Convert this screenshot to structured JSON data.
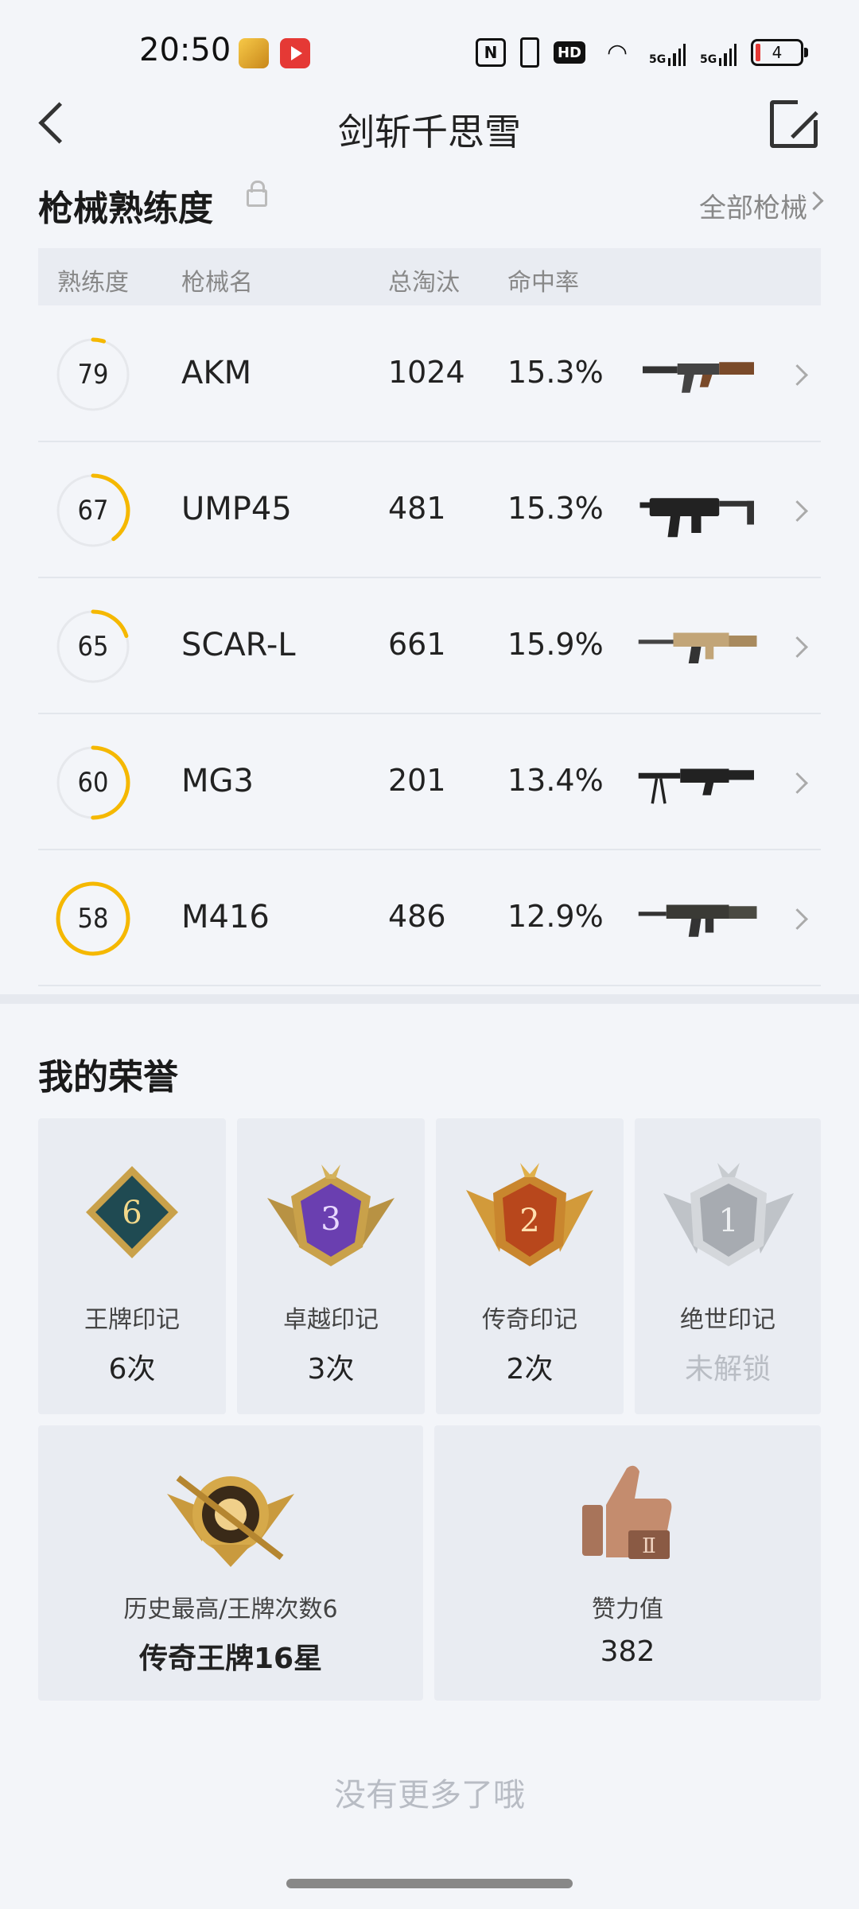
{
  "status_bar": {
    "time": "20:50",
    "icons": [
      "nfc-icon",
      "vibrate-icon",
      "hd-icon",
      "wifi-icon",
      "signal-5g-icon",
      "signal-5g-icon",
      "battery-icon"
    ],
    "hd_label": "HD",
    "sig_label": "5G",
    "battery_level": "4"
  },
  "header": {
    "title": "剑斩千思雪",
    "back_icon": "back-chevron-icon",
    "share_icon": "share-external-icon"
  },
  "weapons": {
    "section_title": "枪械熟练度",
    "all_link": "全部枪械",
    "columns": [
      "熟练度",
      "枪械名",
      "总淘汰",
      "命中率"
    ],
    "rows": [
      {
        "proficiency": "79",
        "progress": 0.05,
        "name": "AKM",
        "kills": "1024",
        "accuracy": "15.3%"
      },
      {
        "proficiency": "67",
        "progress": 0.4,
        "name": "UMP45",
        "kills": "481",
        "accuracy": "15.3%"
      },
      {
        "proficiency": "65",
        "progress": 0.2,
        "name": "SCAR-L",
        "kills": "661",
        "accuracy": "15.9%"
      },
      {
        "proficiency": "60",
        "progress": 0.5,
        "name": "MG3",
        "kills": "201",
        "accuracy": "13.4%"
      },
      {
        "proficiency": "58",
        "progress": 1.0,
        "name": "M416",
        "kills": "486",
        "accuracy": "12.9%"
      }
    ]
  },
  "honors": {
    "section_title": "我的荣誉",
    "badges": [
      {
        "badge_num": "6",
        "label": "王牌印记",
        "value": "6次"
      },
      {
        "badge_num": "3",
        "label": "卓越印记",
        "value": "3次"
      },
      {
        "badge_num": "2",
        "label": "传奇印记",
        "value": "2次"
      },
      {
        "badge_num": "1",
        "label": "绝世印记",
        "value": "未解锁"
      }
    ],
    "highest": {
      "label": "历史最高/王牌次数6",
      "value": "传奇王牌16星"
    },
    "likes": {
      "label": "赞力值",
      "value": "382"
    }
  },
  "footer": {
    "text": "没有更多了哦"
  },
  "colors": {
    "ring_accent": "#f5b800",
    "ring_track": "#e6e8ec",
    "background": "#f3f5f9"
  }
}
